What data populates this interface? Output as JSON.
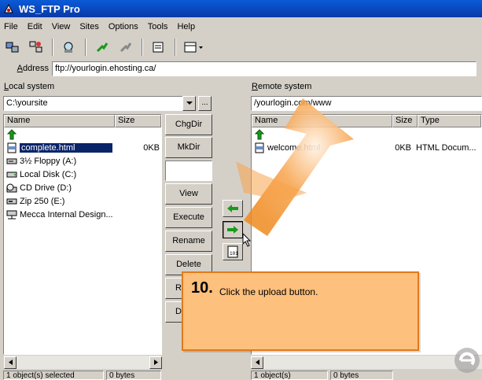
{
  "window": {
    "title": "WS_FTP Pro"
  },
  "menu": [
    "File",
    "Edit",
    "View",
    "Sites",
    "Options",
    "Tools",
    "Help"
  ],
  "toolbar": {
    "icons": [
      "connect-icon",
      "site-manager-icon",
      "find-icon",
      "pin-icon",
      "disconnect-icon",
      "properties-icon",
      "view-options-icon"
    ]
  },
  "address": {
    "label_prefix": "A",
    "label_rest": "ddress",
    "value": "ftp://yourlogin.ehosting.ca/"
  },
  "local": {
    "label_prefix": "L",
    "label_rest": "ocal system",
    "path": "C:\\yoursite",
    "dots": "...",
    "columns": [
      "Name",
      "Size"
    ],
    "items": [
      {
        "name": "",
        "size": "",
        "icon": "up-folder-icon"
      },
      {
        "name": "complete.html",
        "size": "0KB",
        "icon": "html-file-icon"
      },
      {
        "name": "3½ Floppy (A:)",
        "size": "",
        "icon": "floppy-drive-icon"
      },
      {
        "name": "Local Disk (C:)",
        "size": "",
        "icon": "hard-drive-icon"
      },
      {
        "name": "CD Drive (D:)",
        "size": "",
        "icon": "cd-drive-icon"
      },
      {
        "name": "Zip 250  (E:)",
        "size": "",
        "icon": "zip-drive-icon"
      },
      {
        "name": "Mecca Internal Design...",
        "size": "",
        "icon": "network-drive-icon"
      }
    ],
    "status_count": "1 object(s) selected",
    "status_bytes": "0 bytes"
  },
  "side_buttons": {
    "chgdir": "ChgDir",
    "mkdir": "MkDir",
    "view": "View",
    "execute": "Execute",
    "rename": "Rename",
    "delete": "Delete",
    "refresh": "Re",
    "dirinfo": "D"
  },
  "remote": {
    "label_prefix": "R",
    "label_rest": "emote system",
    "path": "/yourlogin.com/www",
    "columns": [
      "Name",
      "Size",
      "Type"
    ],
    "items": [
      {
        "name": "",
        "size": "",
        "type": "",
        "icon": "up-folder-icon"
      },
      {
        "name": "welcome.html",
        "size": "0KB",
        "type": "HTML Docum...",
        "icon": "html-file-icon"
      }
    ],
    "status_count": "1 object(s)",
    "status_bytes": "0 bytes"
  },
  "callout": {
    "number": "10.",
    "text": "Click the upload button."
  },
  "colors": {
    "titlebar": "#0a5bd8",
    "callout_fill": "#fdc07d",
    "callout_border": "#e07a1a",
    "arrow_green": "#1a9a1a"
  }
}
